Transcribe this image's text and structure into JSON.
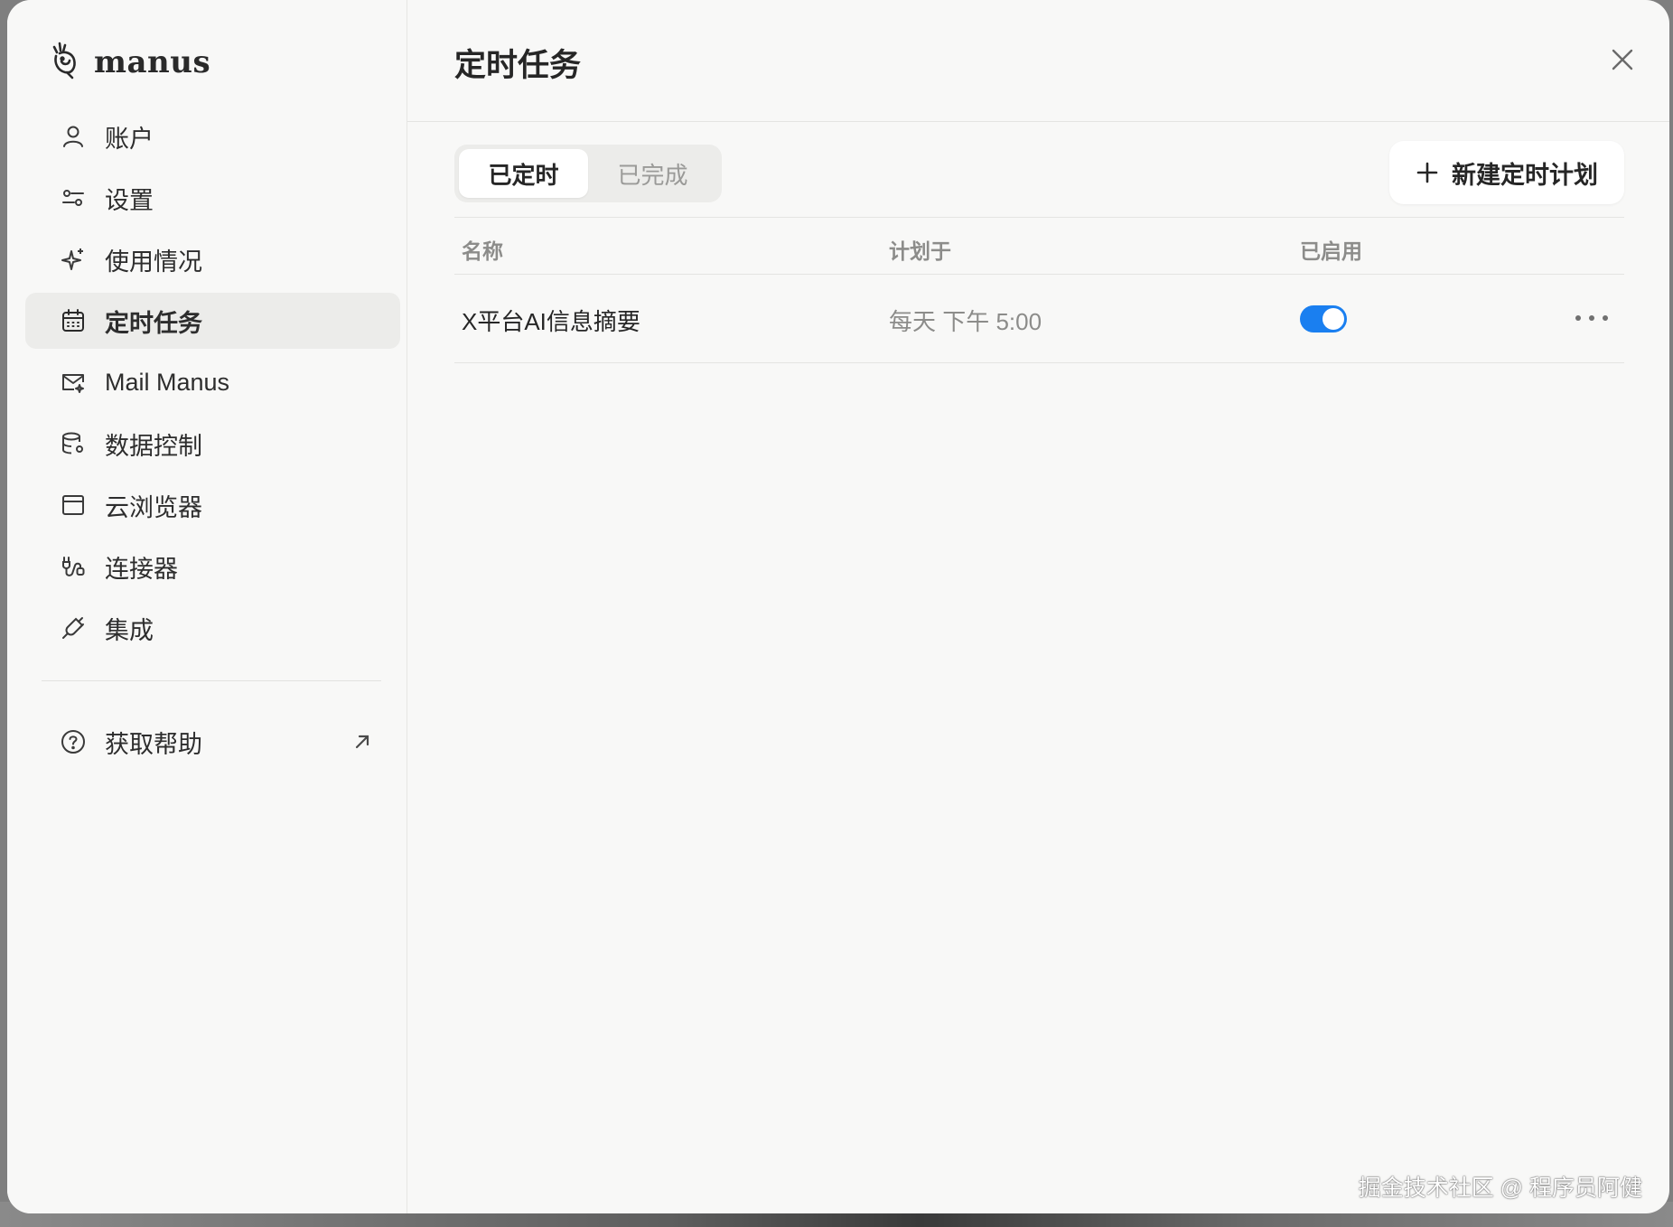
{
  "sidebar": {
    "brand": "manus",
    "items": [
      {
        "label": "账户",
        "icon": "user-icon"
      },
      {
        "label": "设置",
        "icon": "settings-icon"
      },
      {
        "label": "使用情况",
        "icon": "sparkle-icon"
      },
      {
        "label": "定时任务",
        "icon": "calendar-icon",
        "active": true
      },
      {
        "label": "Mail Manus",
        "icon": "mail-icon"
      },
      {
        "label": "数据控制",
        "icon": "database-icon"
      },
      {
        "label": "云浏览器",
        "icon": "browser-icon"
      },
      {
        "label": "连接器",
        "icon": "connector-icon"
      },
      {
        "label": "集成",
        "icon": "plug-icon"
      }
    ],
    "help": {
      "label": "获取帮助",
      "icon": "help-icon"
    }
  },
  "main": {
    "title": "定时任务",
    "tabs": [
      {
        "label": "已定时",
        "active": true
      },
      {
        "label": "已完成",
        "active": false
      }
    ],
    "new_button": "新建定时计划",
    "columns": [
      "名称",
      "计划于",
      "已启用"
    ],
    "rows": [
      {
        "name": "X平台AI信息摘要",
        "schedule": "每天 下午 5:00",
        "enabled": true
      }
    ]
  },
  "watermark": "掘金技术社区 @ 程序员阿健",
  "colors": {
    "accent": "#1a7ff0",
    "background": "#f8f8f7"
  }
}
